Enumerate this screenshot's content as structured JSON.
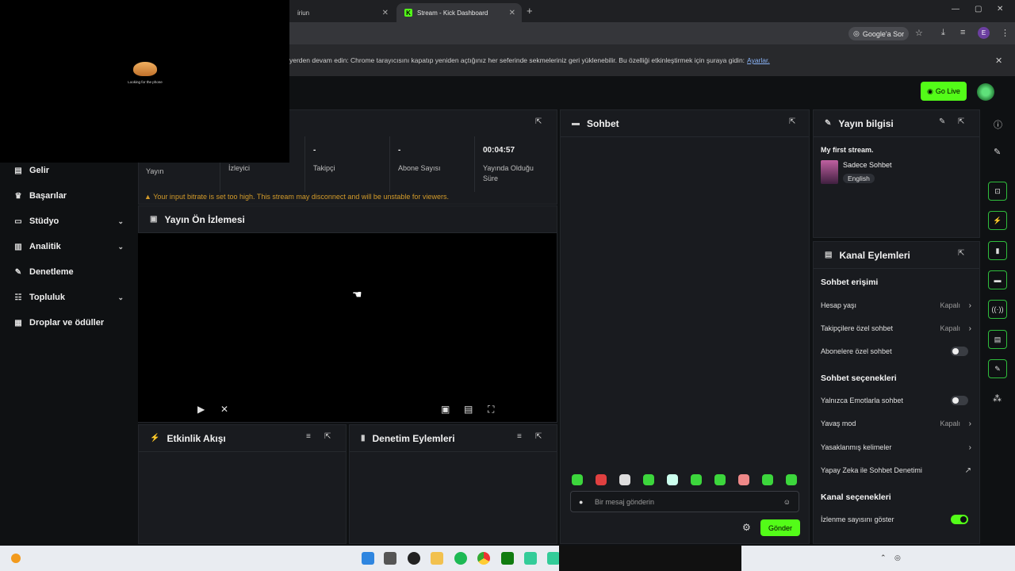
{
  "browser": {
    "tab1_title": "ίriun",
    "tab2_title": "Stream - Kick Dashboard",
    "google_ask": "Google'a Sor",
    "profile_letter": "E",
    "infobar_text": "yerden devam edin: Chrome tarayıcısını kapatıp yeniden açtığınız her seferinde sekmeleriniz geri yüklenebilir. Bu özelliği etkinleştirmek için şuraya gidin:",
    "infobar_link": "Ayarlar."
  },
  "header": {
    "go_live": "Go Live"
  },
  "overlay": {
    "caption": "Looking for the phone"
  },
  "sidebar": {
    "items": [
      {
        "label": "Gelir",
        "icon": "money-icon"
      },
      {
        "label": "Başarılar",
        "icon": "trophy-icon"
      },
      {
        "label": "Stüdyo",
        "icon": "studio-icon"
      },
      {
        "label": "Analitik",
        "icon": "chart-icon"
      },
      {
        "label": "Denetleme",
        "icon": "wrench-icon"
      },
      {
        "label": "Topluluk",
        "icon": "community-icon"
      },
      {
        "label": "Droplar ve ödüller",
        "icon": "gift-icon"
      }
    ]
  },
  "stats": {
    "cells": [
      {
        "value": "",
        "label": "Yayın"
      },
      {
        "value": "",
        "label": "İzleyici"
      },
      {
        "value": "-",
        "label": "Takipçi"
      },
      {
        "value": "-",
        "label": "Abone Sayısı"
      },
      {
        "value": "00:04:57",
        "label": "Yayında Olduğu Süre"
      }
    ],
    "warning": "Your input bitrate is set too high. This stream may disconnect and will be unstable for viewers."
  },
  "preview": {
    "title": "Yayın Ön İzlemesi"
  },
  "activity": {
    "title": "Etkinlik Akışı"
  },
  "moderation": {
    "title": "Denetim Eylemleri"
  },
  "chat": {
    "title": "Sohbet",
    "placeholder": "Bir mesaj gönderin",
    "send": "Gönder"
  },
  "stream_info": {
    "title": "Yayın bilgisi",
    "stream_title": "My first stream.",
    "category": "Sadece Sohbet",
    "language": "English"
  },
  "channel_actions": {
    "title": "Kanal Eylemleri",
    "chat_access": "Sohbet erişimi",
    "account_age": "Hesap yaşı",
    "account_age_val": "Kapalı",
    "followers_only": "Takipçilere özel sohbet",
    "followers_only_val": "Kapalı",
    "subs_only": "Abonelere özel sohbet",
    "chat_options": "Sohbet seçenekleri",
    "emote_only": "Yalnızca Emotlarla sohbet",
    "slow_mode": "Yavaş mod",
    "slow_mode_val": "Kapalı",
    "banned_words": "Yasaklanmış kelimeler",
    "ai_moderation": "Yapay Zeka ile Sohbet Denetimi",
    "channel_options": "Kanal seçenekleri",
    "show_viewers": "İzlenme sayısını göster",
    "show_viewers_on": true
  },
  "colors": {
    "accent": "#53fc18",
    "panel": "#191b1f",
    "background": "#0f1113"
  }
}
